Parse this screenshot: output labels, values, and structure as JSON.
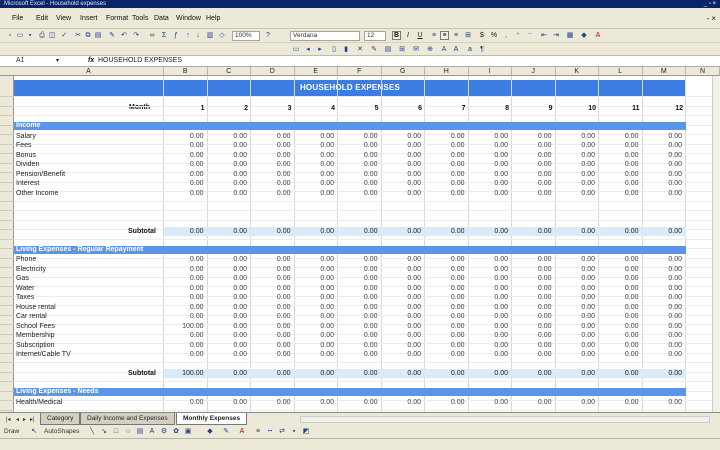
{
  "window": {
    "title": "Microsoft Excel - Household expenses",
    "controls": "_ ▫ ×"
  },
  "menu": {
    "items": [
      "File",
      "Edit",
      "View",
      "Insert",
      "Format",
      "Tools",
      "Data",
      "Window",
      "Help"
    ],
    "close_label": "- ×"
  },
  "toolbar": {
    "zoom": "100%",
    "font": "Verdana",
    "size": "12",
    "bold": "B",
    "italic": "I",
    "underline": "U",
    "currency": "$",
    "percent": "%"
  },
  "formula_bar": {
    "cell_ref": "A1",
    "fx_label": "fx",
    "content": "HOUSEHOLD EXPENSES"
  },
  "columns": [
    "A",
    "B",
    "C",
    "D",
    "E",
    "F",
    "G",
    "H",
    "I",
    "J",
    "K",
    "L",
    "M",
    "N"
  ],
  "sheet": {
    "title": "HOUSEHOLD EXPENSES",
    "month_label": "Month",
    "months": [
      "1",
      "2",
      "3",
      "4",
      "5",
      "6",
      "7",
      "8",
      "9",
      "10",
      "11",
      "12"
    ],
    "subtotal_label": "Subtotal",
    "sections": [
      {
        "name": "Income",
        "rows": [
          {
            "label": "Salary",
            "values": [
              "0.00",
              "0.00",
              "0.00",
              "0.00",
              "0.00",
              "0.00",
              "0.00",
              "0.00",
              "0.00",
              "0.00",
              "0.00",
              "0.00"
            ]
          },
          {
            "label": "Fees",
            "values": [
              "0.00",
              "0.00",
              "0.00",
              "0.00",
              "0.00",
              "0.00",
              "0.00",
              "0.00",
              "0.00",
              "0.00",
              "0.00",
              "0.00"
            ]
          },
          {
            "label": "Bonus",
            "values": [
              "0.00",
              "0.00",
              "0.00",
              "0.00",
              "0.00",
              "0.00",
              "0.00",
              "0.00",
              "0.00",
              "0.00",
              "0.00",
              "0.00"
            ]
          },
          {
            "label": "Dividen",
            "values": [
              "0.00",
              "0.00",
              "0.00",
              "0.00",
              "0.00",
              "0.00",
              "0.00",
              "0.00",
              "0.00",
              "0.00",
              "0.00",
              "0.00"
            ]
          },
          {
            "label": "Pension/Benefit",
            "values": [
              "0.00",
              "0.00",
              "0.00",
              "0.00",
              "0.00",
              "0.00",
              "0.00",
              "0.00",
              "0.00",
              "0.00",
              "0.00",
              "0.00"
            ]
          },
          {
            "label": "Interest",
            "values": [
              "0.00",
              "0.00",
              "0.00",
              "0.00",
              "0.00",
              "0.00",
              "0.00",
              "0.00",
              "0.00",
              "0.00",
              "0.00",
              "0.00"
            ]
          },
          {
            "label": "Other Income",
            "values": [
              "0.00",
              "0.00",
              "0.00",
              "0.00",
              "0.00",
              "0.00",
              "0.00",
              "0.00",
              "0.00",
              "0.00",
              "0.00",
              "0.00"
            ]
          }
        ],
        "subtotals": [
          "0.00",
          "0.00",
          "0.00",
          "0.00",
          "0.00",
          "0.00",
          "0.00",
          "0.00",
          "0.00",
          "0.00",
          "0.00",
          "0.00"
        ]
      },
      {
        "name": "Living Expenses - Regular Repayment",
        "rows": [
          {
            "label": "Phone",
            "values": [
              "0.00",
              "0.00",
              "0.00",
              "0.00",
              "0.00",
              "0.00",
              "0.00",
              "0.00",
              "0.00",
              "0.00",
              "0.00",
              "0.00"
            ]
          },
          {
            "label": "Electricity",
            "values": [
              "0.00",
              "0.00",
              "0.00",
              "0.00",
              "0.00",
              "0.00",
              "0.00",
              "0.00",
              "0.00",
              "0.00",
              "0.00",
              "0.00"
            ]
          },
          {
            "label": "Gas",
            "values": [
              "0.00",
              "0.00",
              "0.00",
              "0.00",
              "0.00",
              "0.00",
              "0.00",
              "0.00",
              "0.00",
              "0.00",
              "0.00",
              "0.00"
            ]
          },
          {
            "label": "Water",
            "values": [
              "0.00",
              "0.00",
              "0.00",
              "0.00",
              "0.00",
              "0.00",
              "0.00",
              "0.00",
              "0.00",
              "0.00",
              "0.00",
              "0.00"
            ]
          },
          {
            "label": "Taxes",
            "values": [
              "0.00",
              "0.00",
              "0.00",
              "0.00",
              "0.00",
              "0.00",
              "0.00",
              "0.00",
              "0.00",
              "0.00",
              "0.00",
              "0.00"
            ]
          },
          {
            "label": "House rental",
            "values": [
              "0.00",
              "0.00",
              "0.00",
              "0.00",
              "0.00",
              "0.00",
              "0.00",
              "0.00",
              "0.00",
              "0.00",
              "0.00",
              "0.00"
            ]
          },
          {
            "label": "Car rental",
            "values": [
              "0.00",
              "0.00",
              "0.00",
              "0.00",
              "0.00",
              "0.00",
              "0.00",
              "0.00",
              "0.00",
              "0.00",
              "0.00",
              "0.00"
            ]
          },
          {
            "label": "School Fees",
            "values": [
              "100.00",
              "0.00",
              "0.00",
              "0.00",
              "0.00",
              "0.00",
              "0.00",
              "0.00",
              "0.00",
              "0.00",
              "0.00",
              "0.00"
            ]
          },
          {
            "label": "Membership",
            "values": [
              "0.00",
              "0.00",
              "0.00",
              "0.00",
              "0.00",
              "0.00",
              "0.00",
              "0.00",
              "0.00",
              "0.00",
              "0.00",
              "0.00"
            ]
          },
          {
            "label": "Subscription",
            "values": [
              "0.00",
              "0.00",
              "0.00",
              "0.00",
              "0.00",
              "0.00",
              "0.00",
              "0.00",
              "0.00",
              "0.00",
              "0.00",
              "0.00"
            ]
          },
          {
            "label": "Internet/Cable TV",
            "values": [
              "0.00",
              "0.00",
              "0.00",
              "0.00",
              "0.00",
              "0.00",
              "0.00",
              "0.00",
              "0.00",
              "0.00",
              "0.00",
              "0.00"
            ]
          }
        ],
        "subtotals": [
          "100.00",
          "0.00",
          "0.00",
          "0.00",
          "0.00",
          "0.00",
          "0.00",
          "0.00",
          "0.00",
          "0.00",
          "0.00",
          "0.00"
        ]
      },
      {
        "name": "Living Expenses - Needs",
        "rows": [
          {
            "label": "Health/Medical",
            "values": [
              "0.00",
              "0.00",
              "0.00",
              "0.00",
              "0.00",
              "0.00",
              "0.00",
              "0.00",
              "0.00",
              "0.00",
              "0.00",
              "0.00"
            ]
          }
        ]
      }
    ]
  },
  "tabs": [
    "Category",
    "Daily Income and Expenses",
    "Monthly Expenses"
  ],
  "active_tab": "Monthly Expenses",
  "drawbar": {
    "draw": "Draw",
    "autoshapes": "AutoShapes"
  }
}
